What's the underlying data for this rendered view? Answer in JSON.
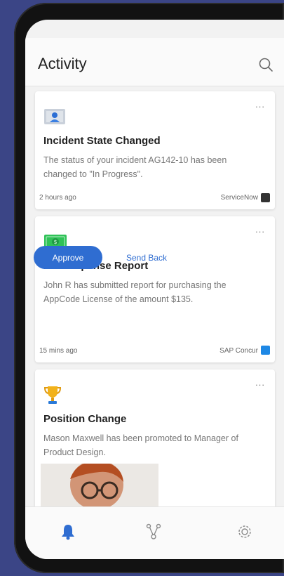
{
  "header": {
    "title": "Activity"
  },
  "cards": [
    {
      "title": "Incident State Changed",
      "description": "The status of your incident AG142-10 has been changed to \"In Progress\".",
      "time": "2 hours ago",
      "source": "ServiceNow",
      "icon": "incident-person-icon"
    },
    {
      "title": "New Expense Report",
      "description": "John R has submitted report for purchasing the AppCode License of the amount $135.",
      "primary_action": "Approve",
      "secondary_action": "Send Back",
      "time": "15 mins ago",
      "source": "SAP Concur",
      "icon": "money-bill-icon"
    },
    {
      "title": "Position Change",
      "description": "Mason Maxwell has been promoted to Manager of Product Design.",
      "icon": "trophy-icon"
    }
  ],
  "more_label": "...",
  "bottom_nav": [
    "bell-icon",
    "network-icon",
    "gear-icon"
  ],
  "colors": {
    "accent": "#2f6dd1",
    "background": "#3b4586"
  }
}
